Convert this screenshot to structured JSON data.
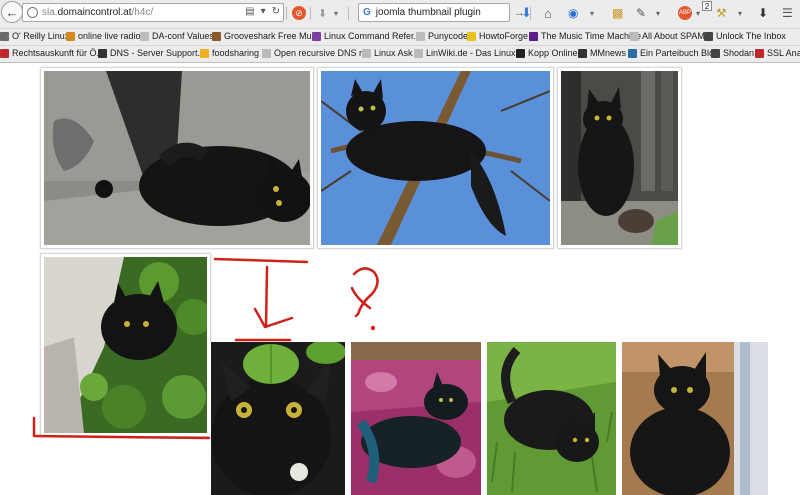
{
  "browser": {
    "url_prefix": "sla.",
    "url_domain": "domaincontrol.at",
    "url_path": "/h4c/",
    "search_query": "joomla thumbnail plugin",
    "badge_count": "2",
    "bookmarks_row1": [
      {
        "label": "O' Reilly Linux",
        "icon": "bookmark-icon",
        "color": "#6a6a6a"
      },
      {
        "label": "online live radio",
        "icon": "bookmark-icon",
        "color": "#d08a1f"
      },
      {
        "label": "DA-conf Values",
        "icon": "page-icon",
        "color": "#bbbbbb"
      },
      {
        "label": "Grooveshark Free Mu...",
        "icon": "music-icon",
        "color": "#8a5a2a"
      },
      {
        "label": "Linux Command Refer...",
        "icon": "linux-icon",
        "color": "#7a3fa0"
      },
      {
        "label": "Punycode",
        "icon": "page-icon",
        "color": "#bbbbbb"
      },
      {
        "label": "HowtoForge",
        "icon": "bulb-icon",
        "color": "#e8c21a"
      },
      {
        "label": "The Music Time Machine",
        "icon": "yahoo-icon",
        "color": "#5a1d8a"
      },
      {
        "label": "All About SPAM",
        "icon": "page-icon",
        "color": "#bbbbbb"
      },
      {
        "label": "Unlock The Inbox",
        "icon": "person-icon",
        "color": "#444444"
      }
    ],
    "bookmarks_row2": [
      {
        "label": "Rechtsauskunft für Ö...",
        "icon": "flag-icon",
        "color": "#c0282d"
      },
      {
        "label": "DNS - Server Support...",
        "icon": "dns-icon",
        "color": "#333333"
      },
      {
        "label": "foodsharing",
        "icon": "sun-icon",
        "color": "#f0b020"
      },
      {
        "label": "Open recursive DNS r...",
        "icon": "page-icon",
        "color": "#bbbbbb"
      },
      {
        "label": "Linux Ask",
        "icon": "page-icon",
        "color": "#bbbbbb"
      },
      {
        "label": "LinWiki.de - Das Linux...",
        "icon": "page-icon",
        "color": "#bbbbbb"
      },
      {
        "label": "Kopp Online",
        "icon": "kopp-icon",
        "color": "#222222"
      },
      {
        "label": "MMnews",
        "icon": "mm-icon",
        "color": "#333333"
      },
      {
        "label": "Ein Parteibuch Blog",
        "icon": "wordpress-icon",
        "color": "#2a6fa8"
      },
      {
        "label": "Shodan",
        "icon": "shodan-icon",
        "color": "#444444"
      },
      {
        "label": "SSL Ana",
        "icon": "ssl-icon",
        "color": "#c0282d"
      }
    ]
  },
  "gallery": {
    "photos": [
      {
        "name": "photo-cat-lying-on-pavement",
        "alt": "black cat lying on pavement"
      },
      {
        "name": "photo-cat-on-branch",
        "alt": "black cat on tree branch"
      },
      {
        "name": "photo-cat-sitting-on-porch",
        "alt": "black cat sitting on wooden porch"
      },
      {
        "name": "photo-cat-in-leaves",
        "alt": "black cat among green leaves"
      },
      {
        "name": "photo-cat-face-closeup",
        "alt": "black cat face close-up with leaf"
      },
      {
        "name": "photo-cat-on-blanket",
        "alt": "black cat on purple blanket"
      },
      {
        "name": "photo-cat-in-grass",
        "alt": "black cat lying in grass"
      },
      {
        "name": "photo-cat-on-floor",
        "alt": "black cat on wooden floor"
      }
    ]
  },
  "annotation": {
    "question_mark": "?",
    "color": "#d0201a"
  }
}
